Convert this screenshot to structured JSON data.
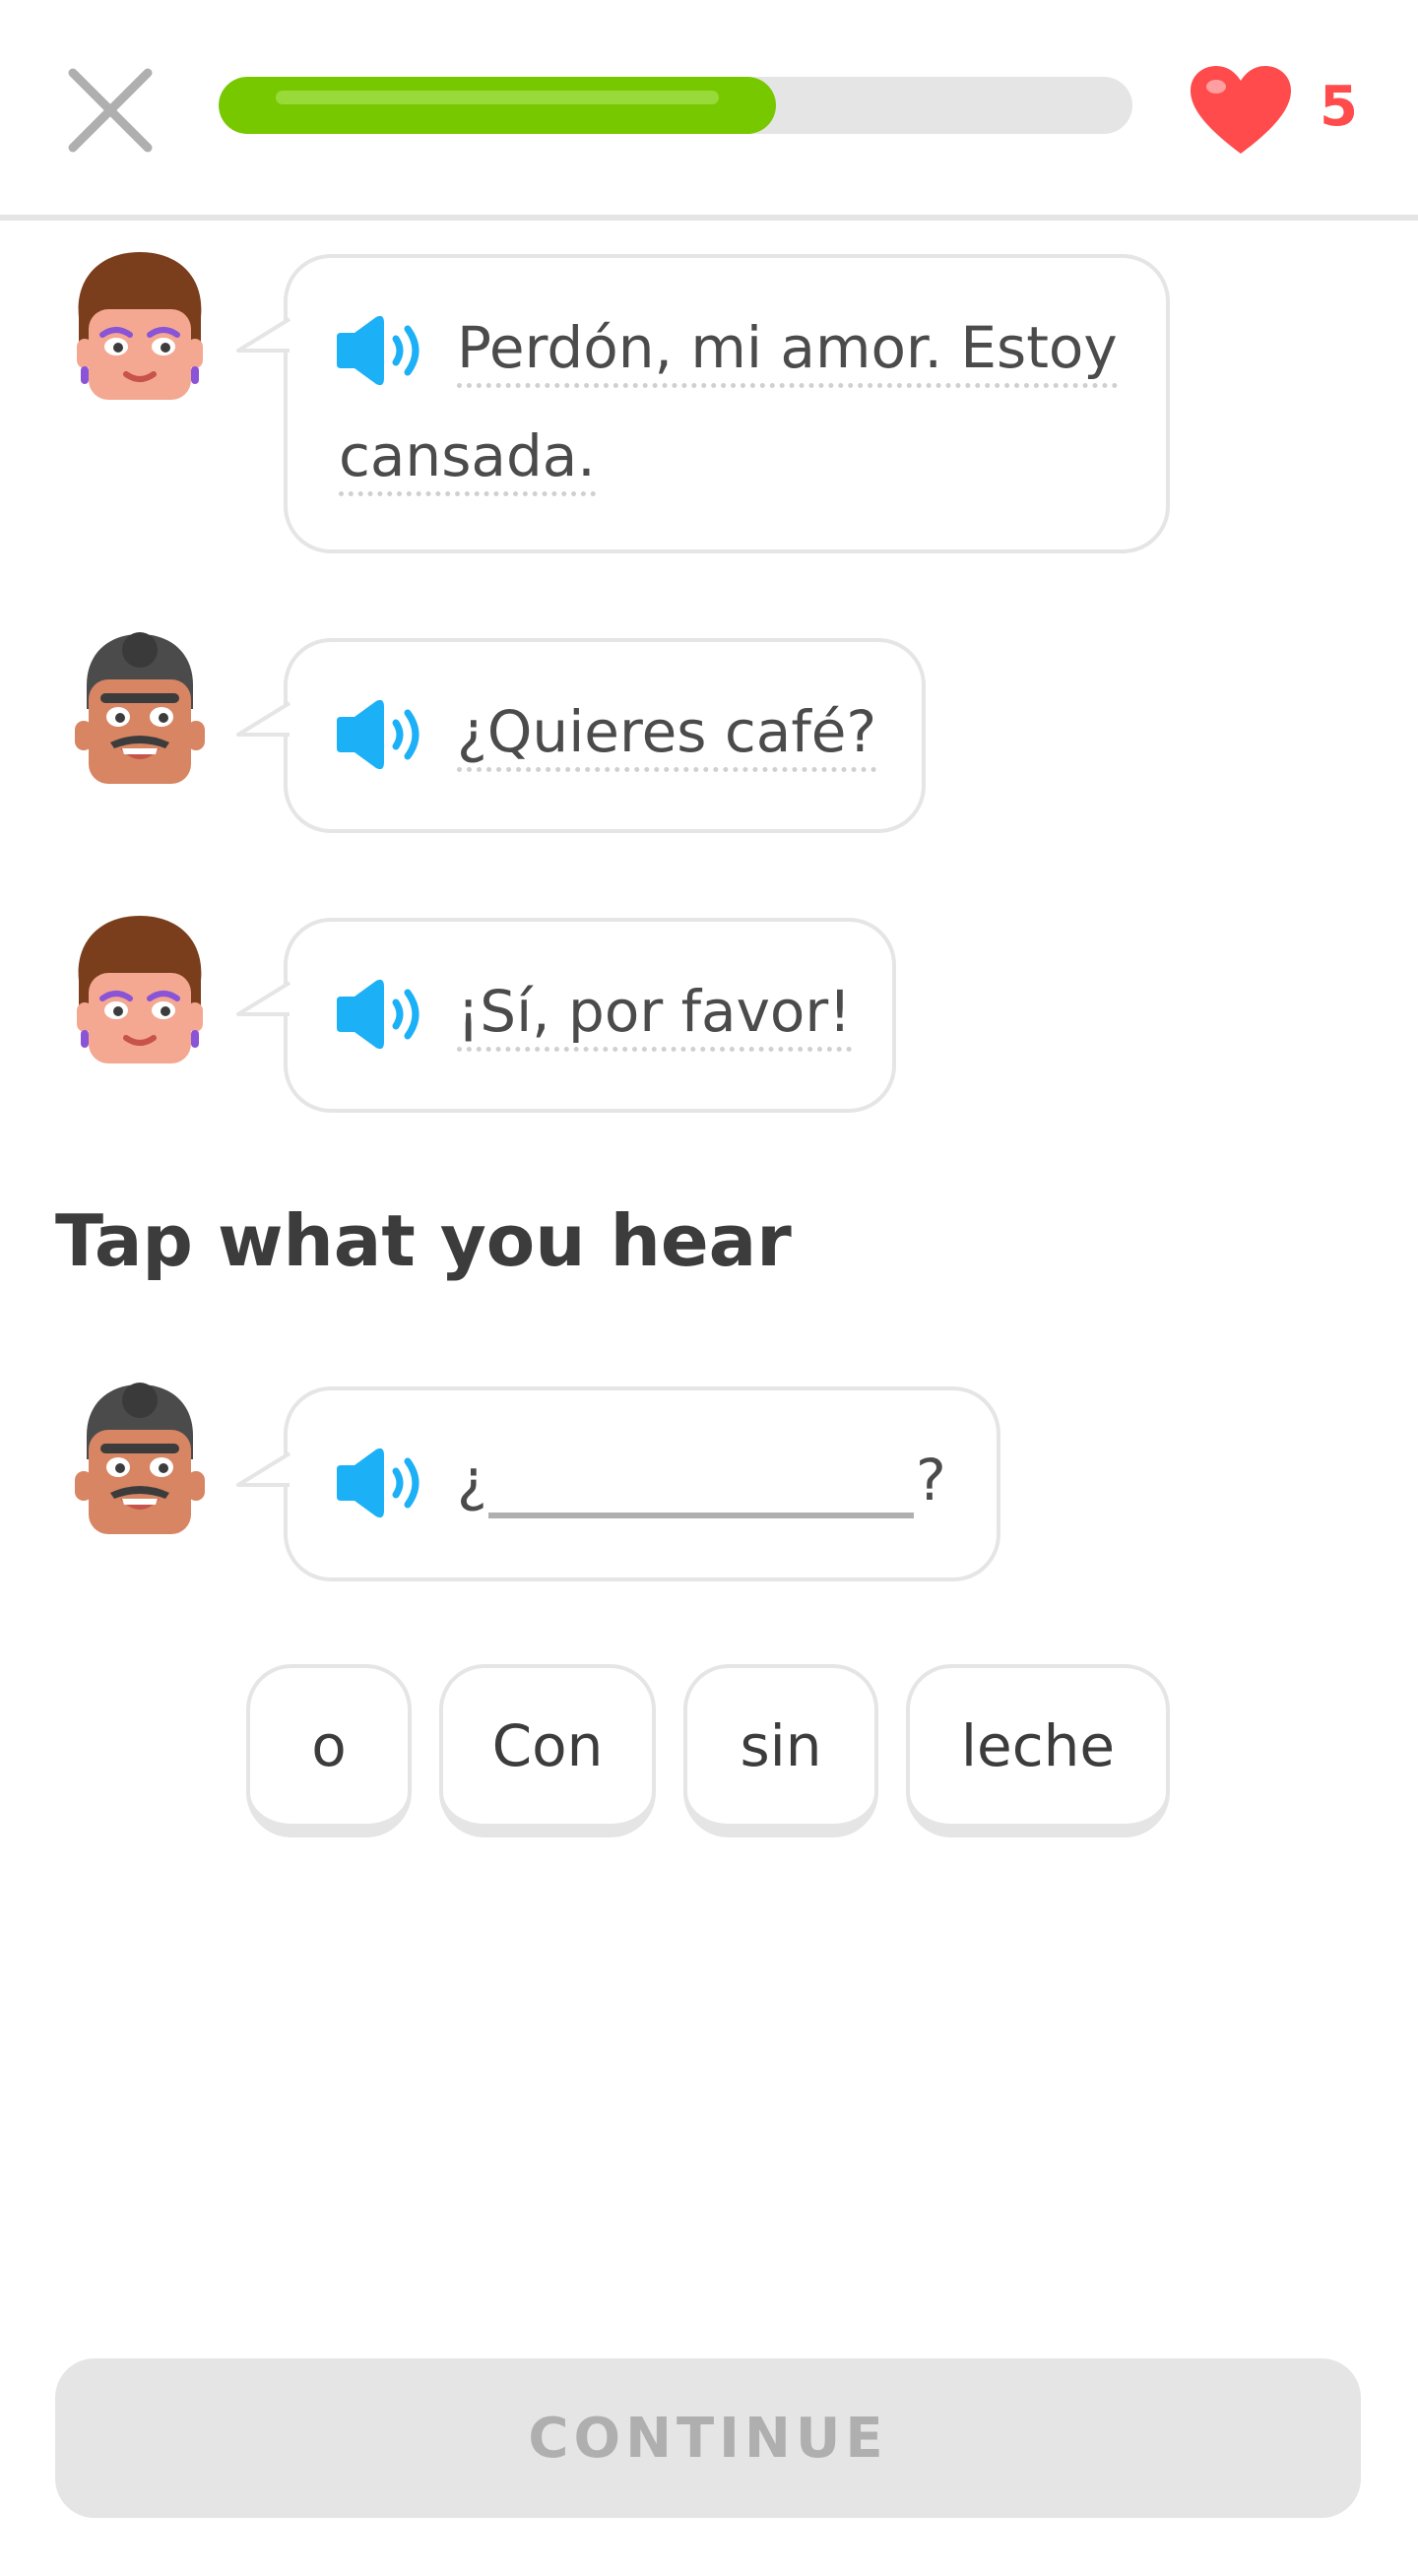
{
  "header": {
    "progress_percent": 61,
    "hearts": "5"
  },
  "conversation": [
    {
      "speaker": "woman",
      "lines": [
        "Perdón, mi amor. Estoy",
        "cansada."
      ]
    },
    {
      "speaker": "man",
      "lines": [
        "¿Quieres café?"
      ]
    },
    {
      "speaker": "woman",
      "lines": [
        "¡Sí, por favor!"
      ]
    }
  ],
  "prompt": {
    "title": "Tap what you hear",
    "open_mark": "¿",
    "close_mark": "?"
  },
  "word_bank": [
    "o",
    "Con",
    "sin",
    "leche"
  ],
  "footer": {
    "continue_label": "CONTINUE"
  },
  "colors": {
    "progress": "#78c800",
    "heart": "#ff4b4b",
    "speaker": "#1cb0f6",
    "disabled_button": "#e5e5e5"
  }
}
